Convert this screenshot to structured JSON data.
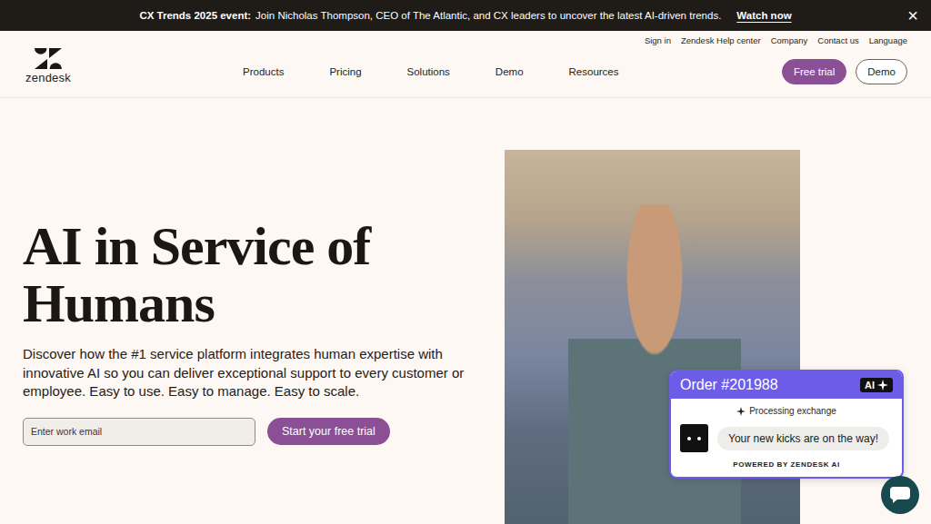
{
  "banner": {
    "title": "CX Trends 2025 event:",
    "text": "Join Nicholas Thompson, CEO of The Atlantic, and CX leaders to uncover the latest AI-driven trends.",
    "link": "Watch now",
    "close": "×"
  },
  "utility_nav": [
    "Sign in",
    "Zendesk Help center",
    "Company",
    "Contact us",
    "Language"
  ],
  "logo": {
    "text": "zendesk"
  },
  "nav": [
    "Products",
    "Pricing",
    "Solutions",
    "Demo",
    "Resources"
  ],
  "header_buttons": {
    "primary": "Free trial",
    "secondary": "Demo"
  },
  "hero": {
    "title": "AI in Service of Humans",
    "subtitle": "Discover how the #1 service platform integrates human expertise with innovative AI so you can deliver exceptional support to every customer or employee. Easy to use. Easy to manage. Easy to scale.",
    "email_placeholder": "Enter work email",
    "cta": "Start your free trial"
  },
  "chat_card": {
    "title": "Order #201988",
    "badge": "AI",
    "status": "Processing exchange",
    "message": "Your new kicks are on the way!",
    "footer": "POWERED BY ZENDESK AI"
  }
}
